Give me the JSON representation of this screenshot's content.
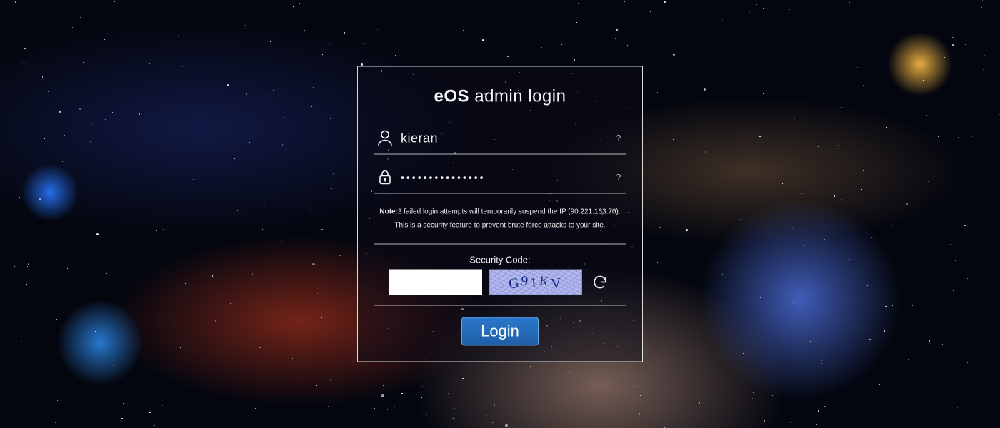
{
  "title_bold": "eOS",
  "title_rest": " admin login",
  "username": {
    "value": "kieran"
  },
  "password": {
    "value": "•••••••••••••••"
  },
  "note_prefix": "Note:",
  "note_line1": "3 failed login attempts will temporarily suspend the IP (90.221.163.70).",
  "note_line2": "This is a security feature to prevent brute force attacks to your site.",
  "security_label": "Security Code:",
  "captcha_chars": [
    "G",
    "9",
    "1",
    "K",
    "V"
  ],
  "login_button": "Login",
  "help_glyph": "?"
}
